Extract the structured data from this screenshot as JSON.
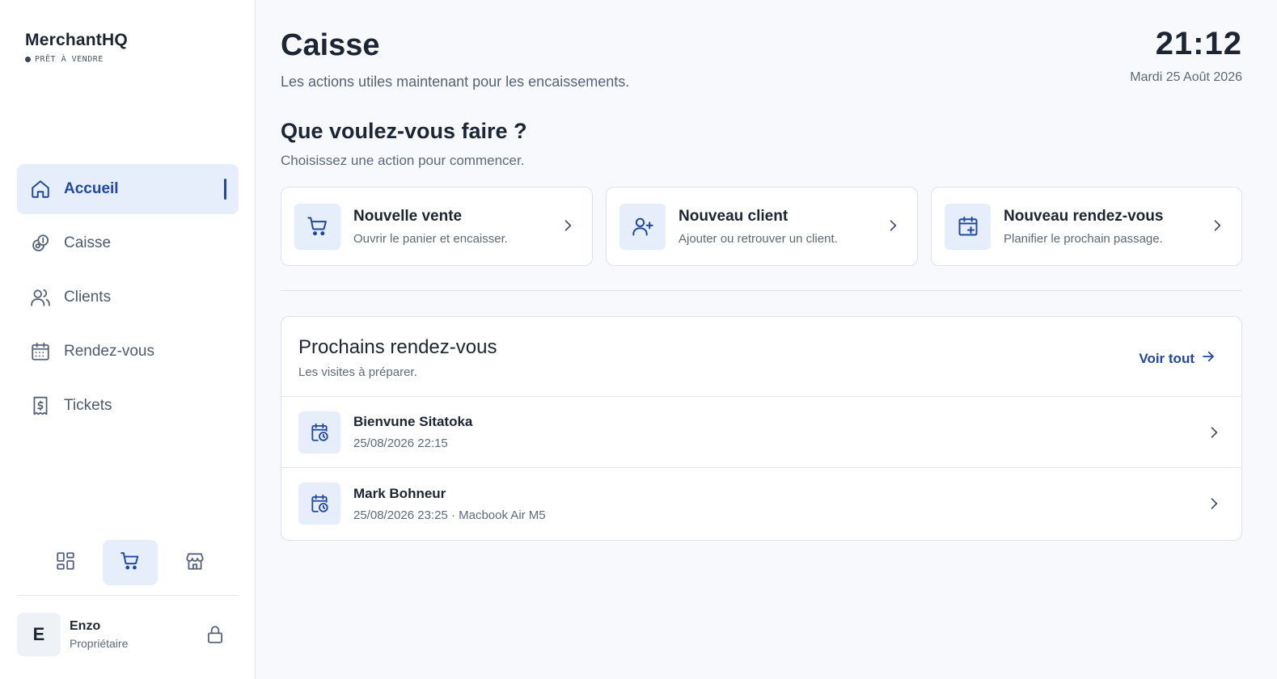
{
  "brand": {
    "name": "MerchantHQ",
    "status": "PRÊT À VENDRE"
  },
  "sidebar": {
    "items": [
      {
        "label": "Accueil",
        "icon": "home-icon",
        "active": true
      },
      {
        "label": "Caisse",
        "icon": "coins-icon",
        "active": false
      },
      {
        "label": "Clients",
        "icon": "users-icon",
        "active": false
      },
      {
        "label": "Rendez-vous",
        "icon": "calendar-icon",
        "active": false
      },
      {
        "label": "Tickets",
        "icon": "receipt-icon",
        "active": false
      }
    ],
    "modes": [
      {
        "icon": "grid-icon",
        "active": false
      },
      {
        "icon": "cart-icon",
        "active": true
      },
      {
        "icon": "store-icon",
        "active": false
      }
    ]
  },
  "user": {
    "initial": "E",
    "name": "Enzo",
    "role": "Propriétaire"
  },
  "header": {
    "title": "Caisse",
    "subtitle": "Les actions utiles maintenant pour les encaissements.",
    "time": "21:12",
    "date": "Mardi 25 Août 2026"
  },
  "actions": {
    "title": "Que voulez-vous faire ?",
    "subtitle": "Choisissez une action pour commencer.",
    "cards": [
      {
        "title": "Nouvelle vente",
        "desc": "Ouvrir le panier et encaisser.",
        "icon": "cart-icon"
      },
      {
        "title": "Nouveau client",
        "desc": "Ajouter ou retrouver un client.",
        "icon": "user-plus-icon"
      },
      {
        "title": "Nouveau rendez-vous",
        "desc": "Planifier le prochain passage.",
        "icon": "calendar-plus-icon"
      }
    ]
  },
  "appointments": {
    "title": "Prochains rendez-vous",
    "subtitle": "Les visites à préparer.",
    "see_all": "Voir tout",
    "rows": [
      {
        "name": "Bienvune Sitatoka",
        "meta": "25/08/2026 22:15"
      },
      {
        "name": "Mark Bohneur",
        "meta": "25/08/2026 23:25 · Macbook Air M5"
      }
    ]
  },
  "colors": {
    "accent": "#1f47a3",
    "accent_bg": "#e7eefb",
    "background": "#f7f9fc"
  }
}
